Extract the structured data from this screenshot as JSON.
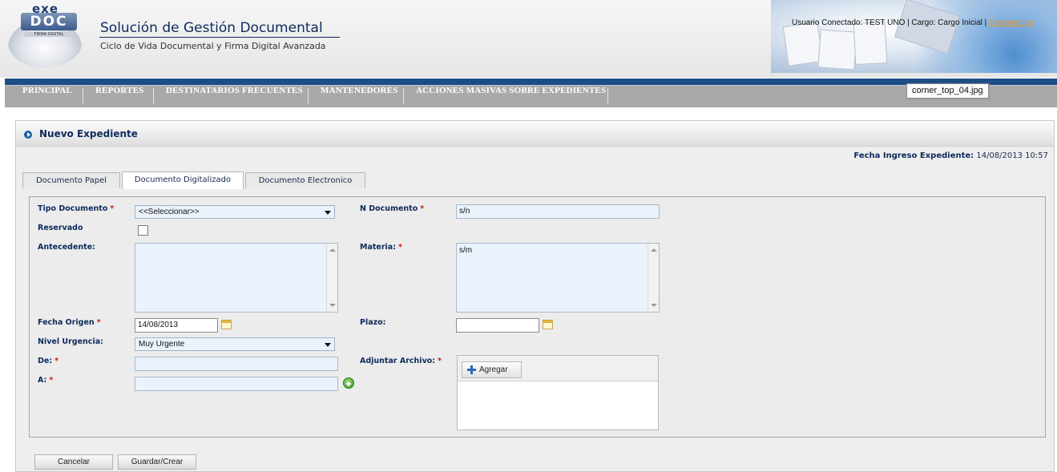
{
  "header": {
    "logo_top": "exe",
    "logo_main": "DOC",
    "logo_tag": "FIRMA DIGITAL",
    "title": "Solución de Gestión Documental",
    "subtitle": "Ciclo de Vida Documental y Firma Digital Avanzada",
    "user_info": "Usuario Conectado: TEST UNO | Cargo: Cargo Inicial |",
    "logout": "Desconectar"
  },
  "menu": {
    "items": [
      "PRINCIPAL",
      "REPORTES",
      "DESTINATARIOS FRECUENTES",
      "MANTENEDORES",
      "ACCIONES MASIVAS SOBRE EXPEDIENTES"
    ]
  },
  "tooltip": "corner_top_04.jpg",
  "panel": {
    "title": "Nuevo Expediente",
    "fecha_label": "Fecha Ingreso Expediente:",
    "fecha_value": "14/08/2013 10:57"
  },
  "tabs": [
    {
      "label": "Documento Papel",
      "active": false
    },
    {
      "label": "Documento Digitalizado",
      "active": true
    },
    {
      "label": "Documento Electronico",
      "active": false
    }
  ],
  "form": {
    "tipo_documento": {
      "label": "Tipo Documento",
      "value": "<<Seleccionar>>"
    },
    "reservado": {
      "label": "Reservado",
      "checked": false
    },
    "antecedente": {
      "label": "Antecedente:",
      "value": ""
    },
    "fecha_origen": {
      "label": "Fecha Origen",
      "value": "14/08/2013"
    },
    "nivel_urgencia": {
      "label": "Nivel Urgencia:",
      "value": "Muy Urgente"
    },
    "de": {
      "label": "De:",
      "value": ""
    },
    "a": {
      "label": "A:",
      "value": ""
    },
    "n_documento": {
      "label": "N Documento",
      "value": "s/n"
    },
    "materia": {
      "label": "Materia:",
      "value": "s/m"
    },
    "plazo": {
      "label": "Plazo:",
      "value": ""
    },
    "adjuntar": {
      "label": "Adjuntar Archivo:",
      "button": "Agregar"
    },
    "required_mark": "*"
  },
  "buttons": {
    "cancel": "Cancelar",
    "save": "Guardar/Crear"
  },
  "colors": {
    "brand_blue": "#1d4d87",
    "menu_gray": "#a9a9a9",
    "required_red": "#d01818",
    "link_orange": "#e8962a",
    "field_bg": "#eaf2fc"
  }
}
